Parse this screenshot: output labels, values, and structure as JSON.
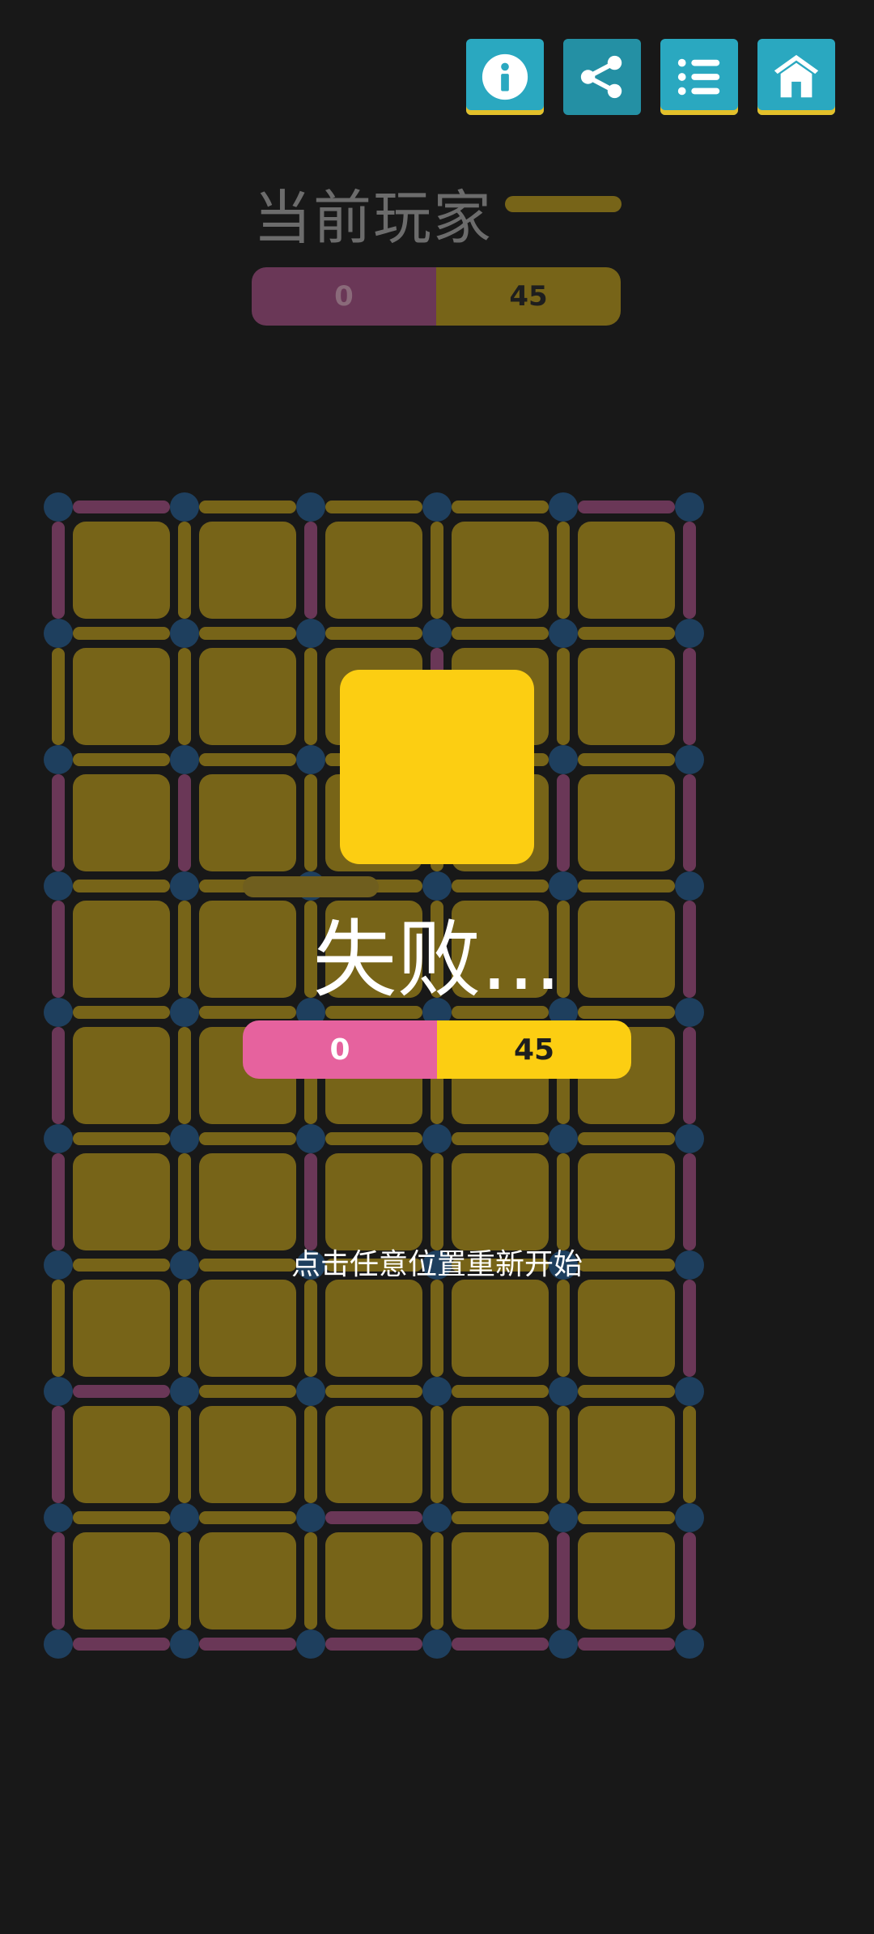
{
  "toolbar": {
    "info_icon": "info-icon",
    "share_icon": "share-icon",
    "list_icon": "list-icon",
    "home_icon": "home-icon"
  },
  "header": {
    "player_label": "当前玩家",
    "scores": {
      "pink": "0",
      "yellow": "45"
    }
  },
  "result": {
    "title": "失败...",
    "scores": {
      "pink": "0",
      "yellow": "45"
    },
    "restart_hint": "点击任意位置重新开始"
  },
  "colors": {
    "background": "#181818",
    "button": "#2aa8c0",
    "pink": "#e6629e",
    "pink_dim": "#6a3757",
    "yellow": "#fcce12",
    "yellow_dim": "#776418",
    "dot": "#1e3f5e"
  },
  "board": {
    "rows": 9,
    "cols": 5,
    "cell_owner": "yellow",
    "h_edges": [
      "PYYYP",
      "YYYYY",
      "YYYYY",
      "YYYYY",
      "YYYYY",
      "YYYYY",
      "YYYYY",
      "PYYYY",
      "YYPYY",
      "PPPPP"
    ],
    "v_edges": [
      "PYPYYP",
      "YYYPYP",
      "PPYYPP",
      "PYYYYP",
      "PYYYYP",
      "PYPYYP",
      "YYYYYP",
      "PYYYYY",
      "PYYYPP"
    ]
  }
}
